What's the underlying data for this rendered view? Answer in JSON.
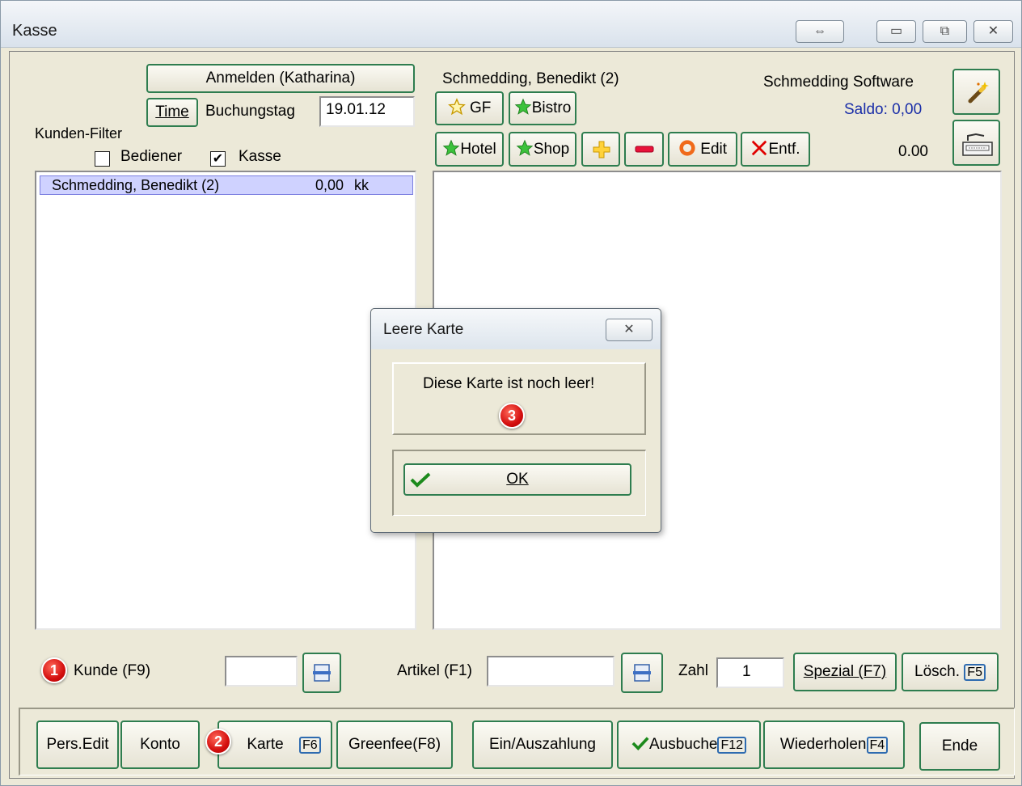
{
  "window": {
    "title": "Kasse",
    "buttons": {
      "swap": "⇔",
      "minimize": "▭",
      "maximize": "⧉",
      "close": "✕"
    }
  },
  "left": {
    "login_button": "Anmelden (Katharina)",
    "time_button": "Time",
    "buchungstag_label": "Buchungstag",
    "buchungstag_value": "19.01.12",
    "filter_label": "Kunden-Filter",
    "filter_bediener_label": "Bediener",
    "filter_bediener_checked": false,
    "filter_kasse_label": "Kasse",
    "filter_kasse_checked": true,
    "customers": [
      {
        "name": "Schmedding, Benedikt (2)",
        "amount": "0,00",
        "code": "kk"
      }
    ]
  },
  "right": {
    "customer_title": "Schmedding, Benedikt (2)",
    "company": "Schmedding Software",
    "saldo": "Saldo: 0,00",
    "total": "0.00",
    "buttons": {
      "gf": "GF",
      "bistro": "Bistro",
      "hotel": "Hotel",
      "shop": "Shop",
      "edit": "Edit",
      "entf": "Entf."
    },
    "icons": {
      "wand": "magic-wand-icon",
      "register": "cash-register-icon"
    }
  },
  "bottom_row": {
    "kunde_label": "Kunde (F9)",
    "kunde_value": "",
    "artikel_label": "Artikel (F1)",
    "artikel_value": "",
    "zahl_label": "Zahl",
    "zahl_value": "1",
    "spezial_button": "Spezial (F7)",
    "loesch_button": "Lösch.",
    "loesch_key": "F5"
  },
  "footer": {
    "pers_edit": "Pers.Edit",
    "konto": "Konto",
    "karte": "Karte",
    "karte_key": "F6",
    "greenfee": "Greenfee(F8)",
    "einauszahlung": "Ein/Auszahlung",
    "ausbuche": "Ausbuche",
    "ausbuche_key": "F12",
    "wiederholen": "Wiederholen",
    "wiederholen_key": "F4",
    "ende": "Ende"
  },
  "dialog": {
    "title": "Leere Karte",
    "message": "Diese Karte ist noch leer!",
    "ok": "OK",
    "close": "✕"
  },
  "markers": [
    "1",
    "2",
    "3"
  ],
  "colors": {
    "accent_border": "#2e7d4f",
    "saldo_text": "#1a2ea8",
    "list_selection": "#cfd2ff",
    "marker": "#d40f0f"
  }
}
